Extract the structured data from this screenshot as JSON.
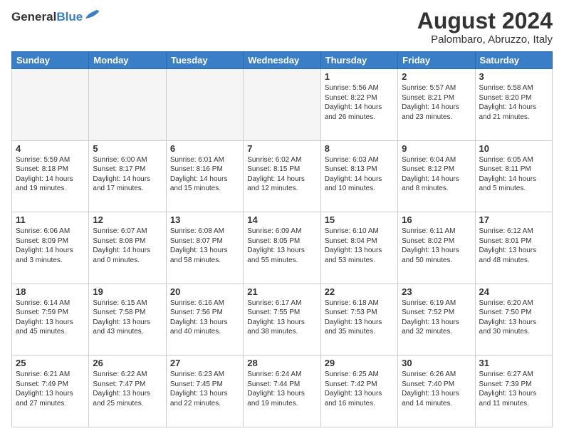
{
  "header": {
    "logo_general": "General",
    "logo_blue": "Blue",
    "title": "August 2024",
    "subtitle": "Palombaro, Abruzzo, Italy"
  },
  "weekdays": [
    "Sunday",
    "Monday",
    "Tuesday",
    "Wednesday",
    "Thursday",
    "Friday",
    "Saturday"
  ],
  "weeks": [
    [
      {
        "day": "",
        "empty": true
      },
      {
        "day": "",
        "empty": true
      },
      {
        "day": "",
        "empty": true
      },
      {
        "day": "",
        "empty": true
      },
      {
        "day": "1",
        "line1": "Sunrise: 5:56 AM",
        "line2": "Sunset: 8:22 PM",
        "line3": "Daylight: 14 hours",
        "line4": "and 26 minutes."
      },
      {
        "day": "2",
        "line1": "Sunrise: 5:57 AM",
        "line2": "Sunset: 8:21 PM",
        "line3": "Daylight: 14 hours",
        "line4": "and 23 minutes."
      },
      {
        "day": "3",
        "line1": "Sunrise: 5:58 AM",
        "line2": "Sunset: 8:20 PM",
        "line3": "Daylight: 14 hours",
        "line4": "and 21 minutes."
      }
    ],
    [
      {
        "day": "4",
        "line1": "Sunrise: 5:59 AM",
        "line2": "Sunset: 8:18 PM",
        "line3": "Daylight: 14 hours",
        "line4": "and 19 minutes."
      },
      {
        "day": "5",
        "line1": "Sunrise: 6:00 AM",
        "line2": "Sunset: 8:17 PM",
        "line3": "Daylight: 14 hours",
        "line4": "and 17 minutes."
      },
      {
        "day": "6",
        "line1": "Sunrise: 6:01 AM",
        "line2": "Sunset: 8:16 PM",
        "line3": "Daylight: 14 hours",
        "line4": "and 15 minutes."
      },
      {
        "day": "7",
        "line1": "Sunrise: 6:02 AM",
        "line2": "Sunset: 8:15 PM",
        "line3": "Daylight: 14 hours",
        "line4": "and 12 minutes."
      },
      {
        "day": "8",
        "line1": "Sunrise: 6:03 AM",
        "line2": "Sunset: 8:13 PM",
        "line3": "Daylight: 14 hours",
        "line4": "and 10 minutes."
      },
      {
        "day": "9",
        "line1": "Sunrise: 6:04 AM",
        "line2": "Sunset: 8:12 PM",
        "line3": "Daylight: 14 hours",
        "line4": "and 8 minutes."
      },
      {
        "day": "10",
        "line1": "Sunrise: 6:05 AM",
        "line2": "Sunset: 8:11 PM",
        "line3": "Daylight: 14 hours",
        "line4": "and 5 minutes."
      }
    ],
    [
      {
        "day": "11",
        "line1": "Sunrise: 6:06 AM",
        "line2": "Sunset: 8:09 PM",
        "line3": "Daylight: 14 hours",
        "line4": "and 3 minutes."
      },
      {
        "day": "12",
        "line1": "Sunrise: 6:07 AM",
        "line2": "Sunset: 8:08 PM",
        "line3": "Daylight: 14 hours",
        "line4": "and 0 minutes."
      },
      {
        "day": "13",
        "line1": "Sunrise: 6:08 AM",
        "line2": "Sunset: 8:07 PM",
        "line3": "Daylight: 13 hours",
        "line4": "and 58 minutes."
      },
      {
        "day": "14",
        "line1": "Sunrise: 6:09 AM",
        "line2": "Sunset: 8:05 PM",
        "line3": "Daylight: 13 hours",
        "line4": "and 55 minutes."
      },
      {
        "day": "15",
        "line1": "Sunrise: 6:10 AM",
        "line2": "Sunset: 8:04 PM",
        "line3": "Daylight: 13 hours",
        "line4": "and 53 minutes."
      },
      {
        "day": "16",
        "line1": "Sunrise: 6:11 AM",
        "line2": "Sunset: 8:02 PM",
        "line3": "Daylight: 13 hours",
        "line4": "and 50 minutes."
      },
      {
        "day": "17",
        "line1": "Sunrise: 6:12 AM",
        "line2": "Sunset: 8:01 PM",
        "line3": "Daylight: 13 hours",
        "line4": "and 48 minutes."
      }
    ],
    [
      {
        "day": "18",
        "line1": "Sunrise: 6:14 AM",
        "line2": "Sunset: 7:59 PM",
        "line3": "Daylight: 13 hours",
        "line4": "and 45 minutes."
      },
      {
        "day": "19",
        "line1": "Sunrise: 6:15 AM",
        "line2": "Sunset: 7:58 PM",
        "line3": "Daylight: 13 hours",
        "line4": "and 43 minutes."
      },
      {
        "day": "20",
        "line1": "Sunrise: 6:16 AM",
        "line2": "Sunset: 7:56 PM",
        "line3": "Daylight: 13 hours",
        "line4": "and 40 minutes."
      },
      {
        "day": "21",
        "line1": "Sunrise: 6:17 AM",
        "line2": "Sunset: 7:55 PM",
        "line3": "Daylight: 13 hours",
        "line4": "and 38 minutes."
      },
      {
        "day": "22",
        "line1": "Sunrise: 6:18 AM",
        "line2": "Sunset: 7:53 PM",
        "line3": "Daylight: 13 hours",
        "line4": "and 35 minutes."
      },
      {
        "day": "23",
        "line1": "Sunrise: 6:19 AM",
        "line2": "Sunset: 7:52 PM",
        "line3": "Daylight: 13 hours",
        "line4": "and 32 minutes."
      },
      {
        "day": "24",
        "line1": "Sunrise: 6:20 AM",
        "line2": "Sunset: 7:50 PM",
        "line3": "Daylight: 13 hours",
        "line4": "and 30 minutes."
      }
    ],
    [
      {
        "day": "25",
        "line1": "Sunrise: 6:21 AM",
        "line2": "Sunset: 7:49 PM",
        "line3": "Daylight: 13 hours",
        "line4": "and 27 minutes."
      },
      {
        "day": "26",
        "line1": "Sunrise: 6:22 AM",
        "line2": "Sunset: 7:47 PM",
        "line3": "Daylight: 13 hours",
        "line4": "and 25 minutes."
      },
      {
        "day": "27",
        "line1": "Sunrise: 6:23 AM",
        "line2": "Sunset: 7:45 PM",
        "line3": "Daylight: 13 hours",
        "line4": "and 22 minutes."
      },
      {
        "day": "28",
        "line1": "Sunrise: 6:24 AM",
        "line2": "Sunset: 7:44 PM",
        "line3": "Daylight: 13 hours",
        "line4": "and 19 minutes."
      },
      {
        "day": "29",
        "line1": "Sunrise: 6:25 AM",
        "line2": "Sunset: 7:42 PM",
        "line3": "Daylight: 13 hours",
        "line4": "and 16 minutes."
      },
      {
        "day": "30",
        "line1": "Sunrise: 6:26 AM",
        "line2": "Sunset: 7:40 PM",
        "line3": "Daylight: 13 hours",
        "line4": "and 14 minutes."
      },
      {
        "day": "31",
        "line1": "Sunrise: 6:27 AM",
        "line2": "Sunset: 7:39 PM",
        "line3": "Daylight: 13 hours",
        "line4": "and 11 minutes."
      }
    ]
  ]
}
